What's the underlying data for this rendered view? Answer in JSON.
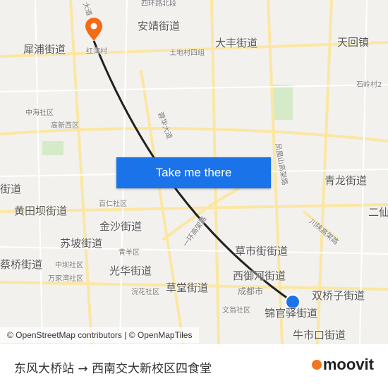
{
  "map": {
    "labels": [
      "犀浦街道",
      "安靖街道",
      "大丰街道",
      "天回镇",
      "中海社区",
      "高新西区",
      "黄田坝街道",
      "百仁社区",
      "金沙街道",
      "苏坡街道",
      "青羊区",
      "光华街道",
      "蔡桥街道",
      "中坝社区",
      "万家湾社区",
      "草市街街道",
      "西御河街道",
      "成都市",
      "草堂街道",
      "浣花社区",
      "文翁社区",
      "锦官驿街道",
      "双桥子街道",
      "牛市口街道",
      "青龙街道",
      "二仙",
      "土地村四组",
      "石岭村2",
      "街道",
      "一环高架路",
      "川陕高架路",
      "凤凰山高架路",
      "蓉华大道",
      "四环路北段",
      "红湾村",
      "大道"
    ],
    "route_color": "#222222",
    "origin_marker_color": "#f56a16",
    "destination_marker_color": "#1a73e8"
  },
  "cta": {
    "label": "Take me there"
  },
  "attribution": "© OpenStreetMap contributors | © OpenMapTiles",
  "footer": {
    "origin": "东风大桥站",
    "arrow": "→",
    "destination": "西南交大新校区四食堂",
    "brand": "moovit"
  }
}
